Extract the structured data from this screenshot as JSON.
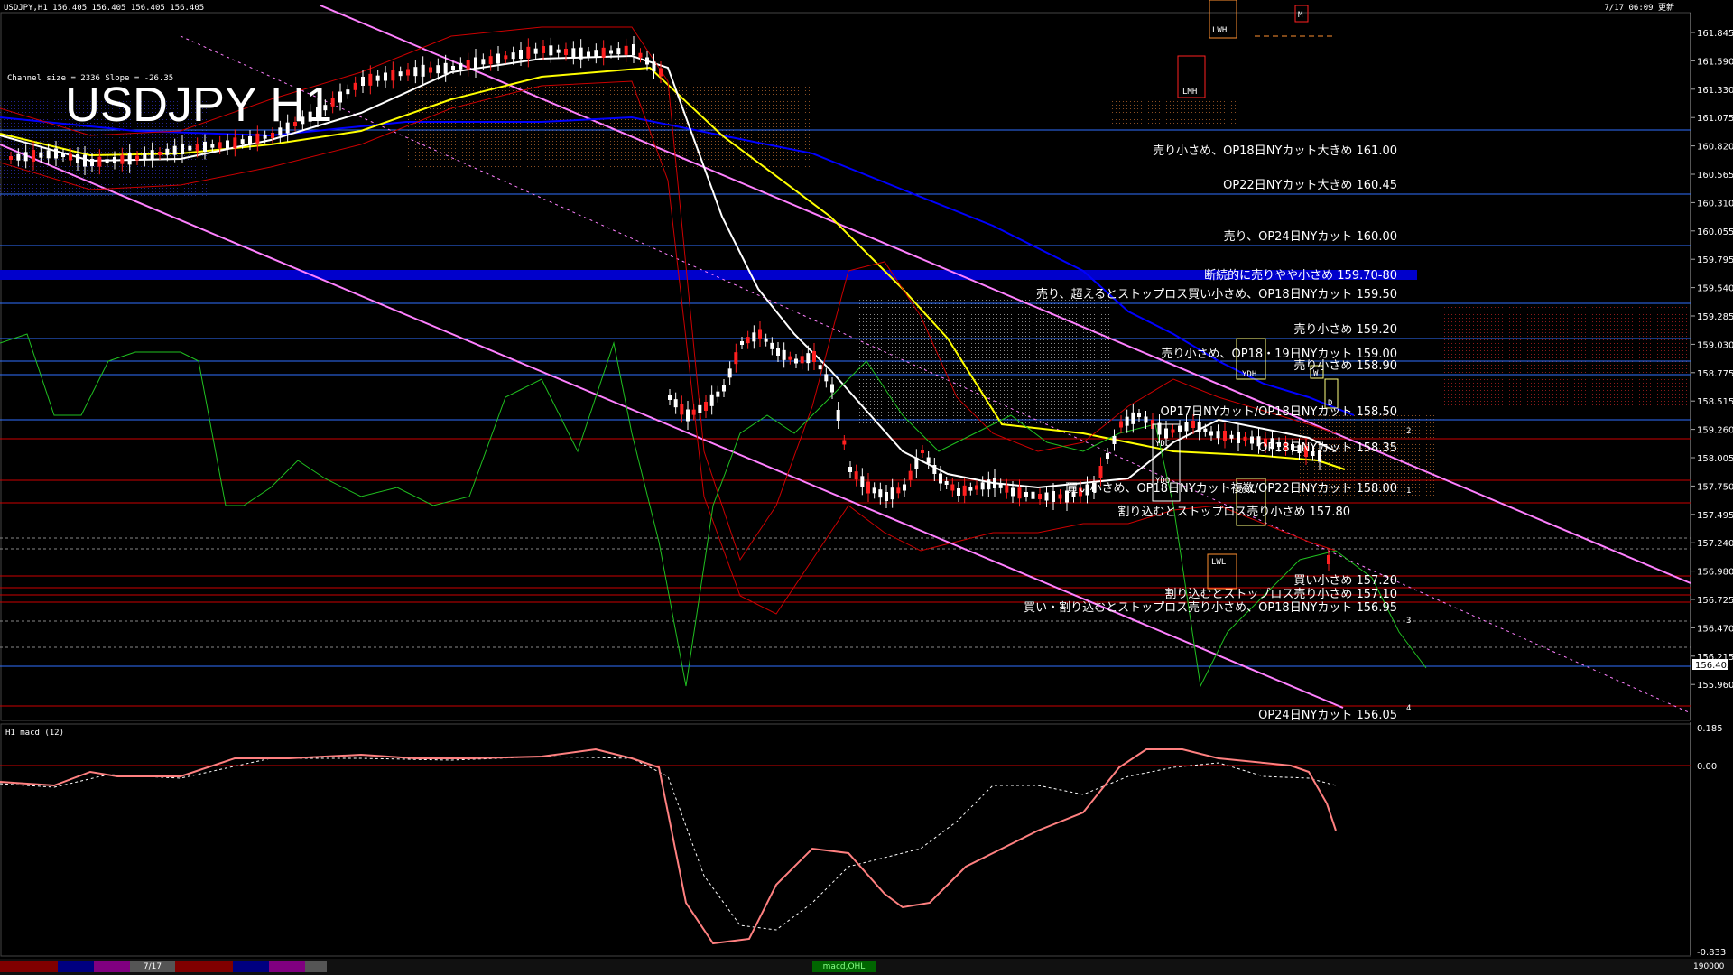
{
  "header": {
    "symbol_info": "USDJPY,H1  156.405 156.405 156.405 156.405",
    "timestamp": "7/17 06:09 更新"
  },
  "chart_title": "USDJPY H1",
  "channel_info": "Channel size = 2336 Slope = -26.35",
  "price_axis": {
    "ticks": [
      "161.845",
      "161.590",
      "161.330",
      "161.075",
      "160.820",
      "160.565",
      "160.310",
      "160.055",
      "159.795",
      "159.540",
      "159.285",
      "159.030",
      "158.775",
      "158.515",
      "159.260",
      "158.005",
      "157.750",
      "157.495",
      "157.240",
      "156.980",
      "156.725",
      "156.470",
      "156.215",
      "155.960"
    ],
    "current_price": "156.405"
  },
  "levels": [
    {
      "label": "売り小さめ、OP18日NYカット大きめ 161.00"
    },
    {
      "label": "OP22日NYカット大きめ 160.45"
    },
    {
      "label": "売り、OP24日NYカット 160.00"
    },
    {
      "label": "断続的に売りやや小さめ 159.70-80"
    },
    {
      "label": "売り、超えるとストップロス買い小さめ、OP18日NYカット 159.50"
    },
    {
      "label": "売り小さめ 159.20"
    },
    {
      "label": "売り小さめ、OP18・19日NYカット 159.00"
    },
    {
      "label": "売り小さめ 158.90"
    },
    {
      "label": "OP17日NYカット/OP18日NYカット 158.50"
    },
    {
      "label": "OP18日NYカット 158.35"
    },
    {
      "label": "買い小さめ、OP18日NYカット複数/OP22日NYカット 158.00"
    },
    {
      "label": "割り込むとストップロス売り小さめ 157.80"
    },
    {
      "label": "買い小さめ 157.20"
    },
    {
      "label": "割り込むとストップロス売り小さめ 157.10"
    },
    {
      "label": "買い・割り込むとストップロス売り小さめ、OP18日NYカット 156.95"
    },
    {
      "label": "OP24日NYカット 156.05"
    }
  ],
  "markers": {
    "lwh": "LWH",
    "lmh": "LMH",
    "m": "M",
    "ydh": "YDH",
    "w": "W",
    "d": "D",
    "ydc": "YDC",
    "ydo": "YDO",
    "ydl": "YDL",
    "lwl": "LWL",
    "n1": "1",
    "n2": "2",
    "n3": "3",
    "n4": "4"
  },
  "macd": {
    "title": "H1  macd (12)",
    "ticks": [
      "0.185",
      "0.00",
      "-0.833"
    ]
  },
  "status_bar": {
    "date_tab": "7/17",
    "center_label": "macd,OHL",
    "right_value": "190000"
  },
  "colors": {
    "background": "#000000",
    "channel": "#ff80ff",
    "ma_yellow": "#ffff00",
    "ma_blue": "#0000ff",
    "macd_main": "#ff8080",
    "macd_up": "#40ff40"
  }
}
